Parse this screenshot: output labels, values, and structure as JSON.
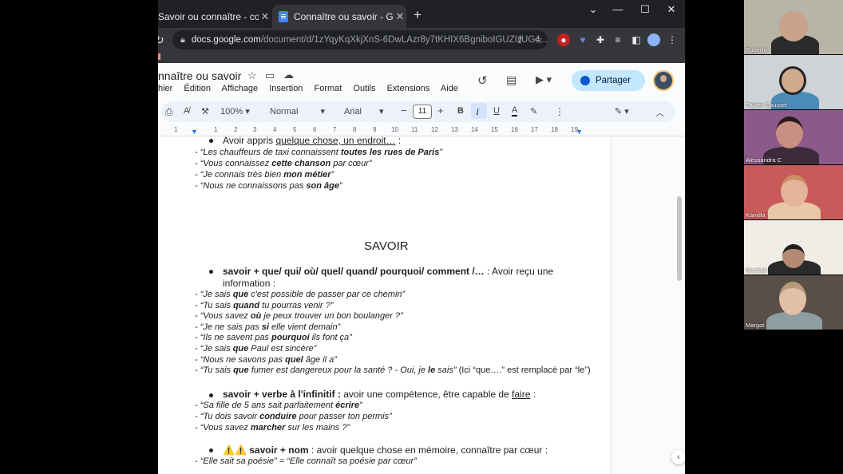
{
  "browser": {
    "tabs": [
      {
        "title": "Savoir ou connaître - cours - Exe",
        "active": false
      },
      {
        "title": "Connaître ou savoir - Google Do",
        "active": true
      }
    ],
    "url_host": "docs.google.com",
    "url_path": "/document/d/1zYqyKqXkjXnS-6DwLAzr8y7tKHIX6BgniboIGUZUUG4..."
  },
  "docs": {
    "title": "nnaître ou savoir",
    "menus": [
      "hier",
      "Édition",
      "Affichage",
      "Insertion",
      "Format",
      "Outils",
      "Extensions",
      "Aide"
    ],
    "share_label": "Partager",
    "toolbar": {
      "zoom": "100%",
      "style": "Normal",
      "font": "Arial",
      "font_size": "11",
      "bold": "B",
      "italic": "I",
      "underline": "U",
      "text_color": "A"
    },
    "ruler_numbers": [
      "1",
      "1",
      "2",
      "3",
      "4",
      "5",
      "6",
      "7",
      "8",
      "9",
      "10",
      "11",
      "12",
      "13",
      "14",
      "15",
      "16",
      "17",
      "18",
      "19"
    ]
  },
  "document": {
    "top_bullet": {
      "text": "Avoir appris ",
      "underlined": "quelque chose, un endroit…",
      "tail": " :"
    },
    "connaitre_examples": [
      {
        "pre": "- “Les chauffeurs de taxi connaissent ",
        "bold": "toutes les rues de Paris",
        "post": "”"
      },
      {
        "pre": "- “Vous connaissez ",
        "bold": "cette chanson",
        "post": " par cœur”"
      },
      {
        "pre": "- “Je connais très bien ",
        "bold": "mon métier",
        "post": "”"
      },
      {
        "pre": "- “Nous ne connaissons pas ",
        "bold": "son âge",
        "post": "”"
      }
    ],
    "heading": "SAVOIR",
    "bullet1": {
      "bold": "savoir + que/ qui/ où/ quel/ quand/ pourquoi/ comment /…",
      "rest": " : Avoir reçu une",
      "line2": "information :"
    },
    "savoir_examples": [
      {
        "pre": "- “Je sais ",
        "bold": "que",
        "post": " c'est possible de passer par ce chemin”"
      },
      {
        "pre": "- “Tu sais ",
        "bold": "quand",
        "post": " tu pourras venir ?”"
      },
      {
        "pre": "-  “Vous savez ",
        "bold": "où",
        "post": " je peux trouver un bon boulanger ?”"
      },
      {
        "pre": "- “Je ne sais pas ",
        "bold": "si",
        "post": " elle vient demain”"
      },
      {
        "pre": "- “Ils ne savent pas ",
        "bold": "pourquoi",
        "post": " ils font ça”"
      },
      {
        "pre": "- “Je sais ",
        "bold": "que",
        "post": " Paul est sincère”"
      },
      {
        "pre": "- “Nous ne savons pas ",
        "bold": "quel",
        "post": " âge il a”"
      },
      {
        "pre": "- “Tu sais ",
        "bold": "que",
        "post": " fumer est dangereux pour la santé ? - Oui, je ",
        "bold2": "le",
        "post2": " sais”",
        "note": " (Ici “que….” est remplacé par “le”)"
      }
    ],
    "bullet2": {
      "bold": "savoir + verbe à l'infinitif :",
      "rest": " avoir une compétence, être capable de ",
      "underlined": "faire",
      "tail": " :"
    },
    "infinitif_examples": [
      {
        "pre": "- “Sa fille de 5 ans sait parfaitement ",
        "bold": "écrire",
        "post": "”"
      },
      {
        "pre": "- “Tu dois savoir ",
        "bold": "conduire",
        "post": " pour passer ton permis”"
      },
      {
        "pre": "- “Vous savez ",
        "bold": "marcher",
        "post": " sur les mains ?”"
      }
    ],
    "bullet3": {
      "warn": "⚠️⚠️",
      "bold": " savoir + nom",
      "rest": " : avoir quelque chose en mémoire, connaître par cœur :"
    },
    "nom_example": "- “Elle sait sa poésie” = “Elle connaît sa poésie par cœur”"
  },
  "participants": [
    "Roberto",
    "Fabien Sausset",
    "Alessandra C",
    "Kamilla",
    "Nicolaia",
    "Margot"
  ]
}
